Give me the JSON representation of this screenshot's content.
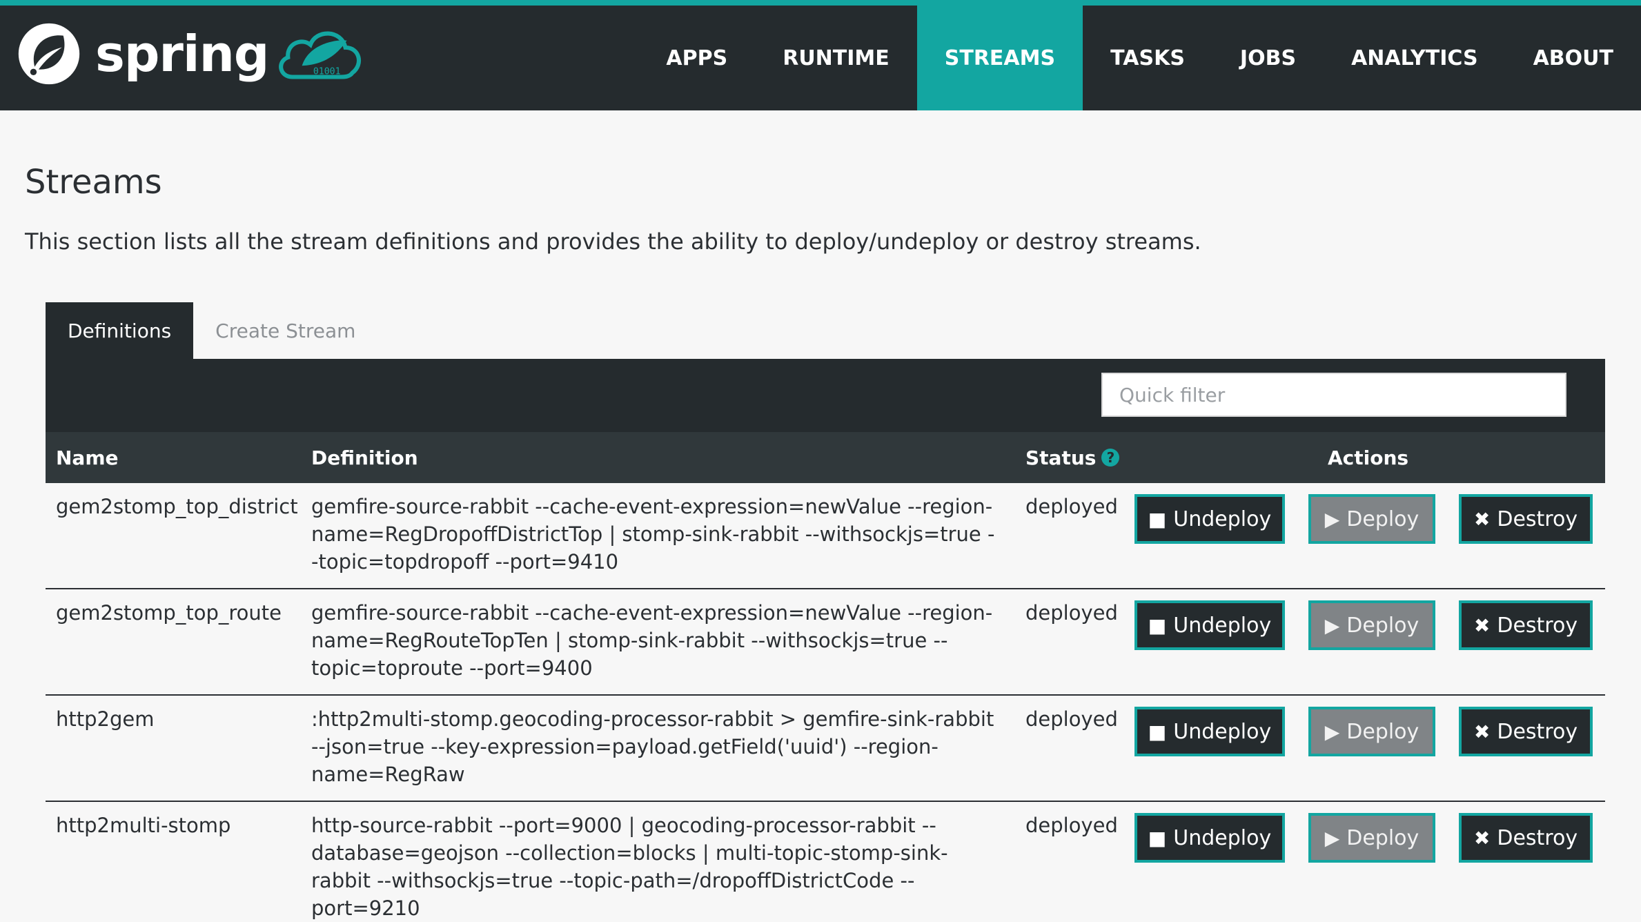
{
  "brand": {
    "name": "spring"
  },
  "nav": {
    "items": [
      {
        "label": "APPS"
      },
      {
        "label": "RUNTIME"
      },
      {
        "label": "STREAMS"
      },
      {
        "label": "TASKS"
      },
      {
        "label": "JOBS"
      },
      {
        "label": "ANALYTICS"
      },
      {
        "label": "ABOUT"
      }
    ],
    "active": "STREAMS"
  },
  "page": {
    "title": "Streams",
    "description": "This section lists all the stream definitions and provides the ability to deploy/undeploy or destroy streams."
  },
  "tabs": [
    {
      "label": "Definitions",
      "active": true
    },
    {
      "label": "Create Stream",
      "active": false
    }
  ],
  "filter": {
    "placeholder": "Quick filter",
    "value": ""
  },
  "table": {
    "headers": {
      "name": "Name",
      "definition": "Definition",
      "status": "Status",
      "status_help_icon": "question-circle-icon",
      "actions": "Actions"
    },
    "action_labels": {
      "undeploy": "Undeploy",
      "deploy": "Deploy",
      "destroy": "Destroy"
    },
    "action_icons": {
      "undeploy": "stop-square-icon",
      "deploy": "play-triangle-icon",
      "destroy": "x-icon"
    },
    "rows": [
      {
        "name": "gem2stomp_top_district",
        "definition": "gemfire-source-rabbit --cache-event-expression=newValue --region-name=RegDropoffDistrictTop | stomp-sink-rabbit --withsockjs=true --topic=topdropoff --port=9410",
        "status": "deployed"
      },
      {
        "name": "gem2stomp_top_route",
        "definition": "gemfire-source-rabbit --cache-event-expression=newValue --region-name=RegRouteTopTen | stomp-sink-rabbit --withsockjs=true --topic=toproute --port=9400",
        "status": "deployed"
      },
      {
        "name": "http2gem",
        "definition": ":http2multi-stomp.geocoding-processor-rabbit > gemfire-sink-rabbit --json=true --key-expression=payload.getField('uuid') --region-name=RegRaw",
        "status": "deployed"
      },
      {
        "name": "http2multi-stomp",
        "definition": "http-source-rabbit --port=9000 | geocoding-processor-rabbit --database=geojson --collection=blocks | multi-topic-stomp-sink-rabbit --withsockjs=true --topic-path=/dropoffDistrictCode --port=9210",
        "status": "deployed"
      }
    ]
  },
  "colors": {
    "accent": "#13a6a1",
    "header_bg": "#252b2e",
    "table_head_bg": "#30383b",
    "page_bg": "#f7f7f7",
    "deploy_button_bg": "#808487"
  }
}
